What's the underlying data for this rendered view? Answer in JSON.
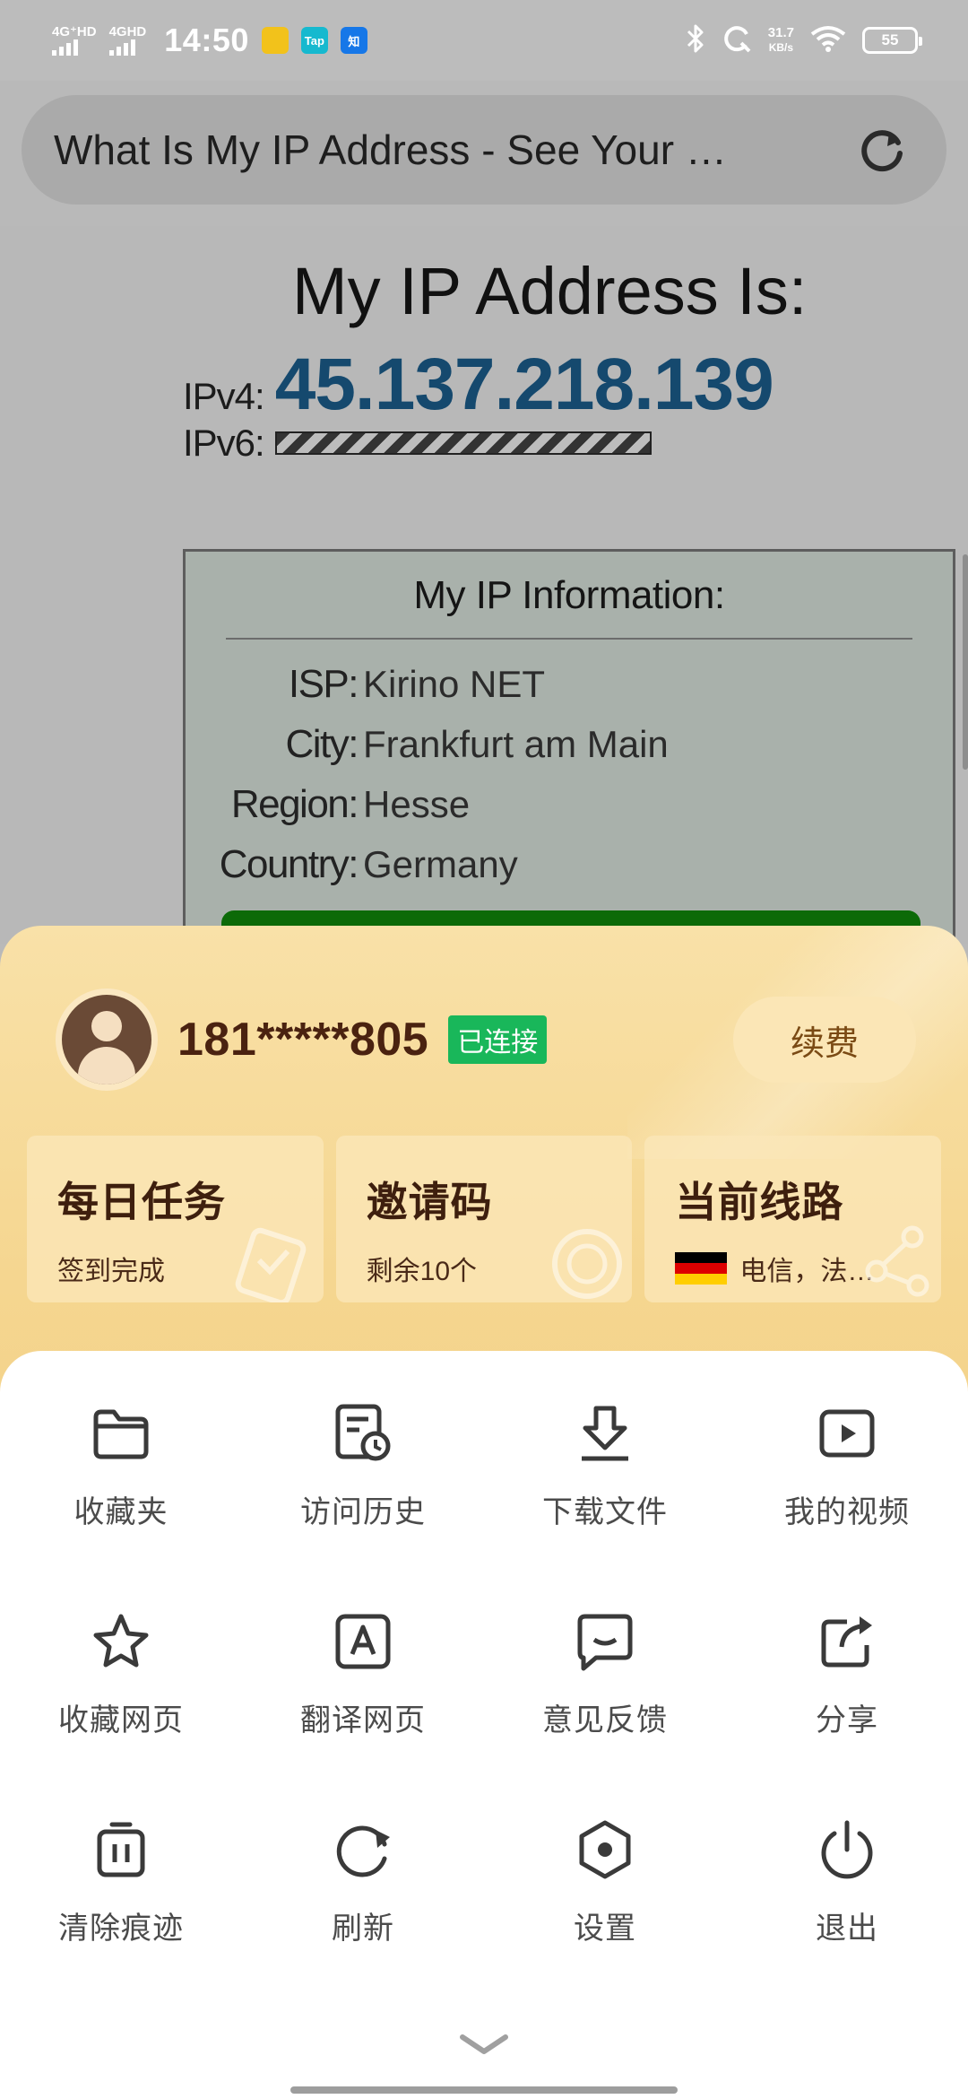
{
  "status_bar": {
    "net1": "4G⁺HD",
    "net2": "4GHD",
    "time": "14:50",
    "apps": [
      {
        "name": "app-yellow-icon",
        "glyph": "",
        "color": "#f2c21b"
      },
      {
        "name": "taptap-icon",
        "glyph": "Tap",
        "color": "#16b9cf"
      },
      {
        "name": "zhihu-icon",
        "glyph": "知",
        "color": "#1677e8"
      }
    ],
    "speed_value": "31.7",
    "speed_unit": "KB/s",
    "battery": "55"
  },
  "address_bar": {
    "title": "What Is My IP Address - See Your …"
  },
  "web": {
    "heading": "My IP Address Is:",
    "ipv4_label": "IPv4:",
    "ipv4_value": "45.137.218.139",
    "ipv6_label": "IPv6:",
    "info_title": "My IP Information:",
    "info_rows": [
      {
        "key": "ISP:",
        "value": "Kirino NET"
      },
      {
        "key": "City:",
        "value": "Frankfurt am Main"
      },
      {
        "key": "Region:",
        "value": "Hesse"
      },
      {
        "key": "Country:",
        "value": "Germany"
      }
    ]
  },
  "sheet": {
    "username": "181*****805",
    "status_badge": "已连接",
    "renew_label": "续费",
    "cards": [
      {
        "title": "每日任务",
        "subtitle": "签到完成"
      },
      {
        "title": "邀请码",
        "subtitle": "剩余10个"
      },
      {
        "title": "当前线路",
        "subtitle": "电信，法…"
      }
    ]
  },
  "menu": {
    "items": [
      {
        "label": "收藏夹",
        "icon": "folder-icon"
      },
      {
        "label": "访问历史",
        "icon": "history-icon"
      },
      {
        "label": "下载文件",
        "icon": "download-icon"
      },
      {
        "label": "我的视频",
        "icon": "video-icon"
      },
      {
        "label": "收藏网页",
        "icon": "star-icon"
      },
      {
        "label": "翻译网页",
        "icon": "translate-icon"
      },
      {
        "label": "意见反馈",
        "icon": "feedback-icon"
      },
      {
        "label": "分享",
        "icon": "share-icon"
      },
      {
        "label": "清除痕迹",
        "icon": "trash-icon"
      },
      {
        "label": "刷新",
        "icon": "refresh-icon"
      },
      {
        "label": "设置",
        "icon": "settings-icon"
      },
      {
        "label": "退出",
        "icon": "power-icon"
      }
    ]
  },
  "colors": {
    "ip_blue": "#15496e",
    "connected_green": "#19b75a",
    "gold": "#f3cf83",
    "brown_text": "#4a2210",
    "flag_black": "#000000",
    "flag_red": "#dd0000",
    "flag_gold": "#ffce00"
  }
}
